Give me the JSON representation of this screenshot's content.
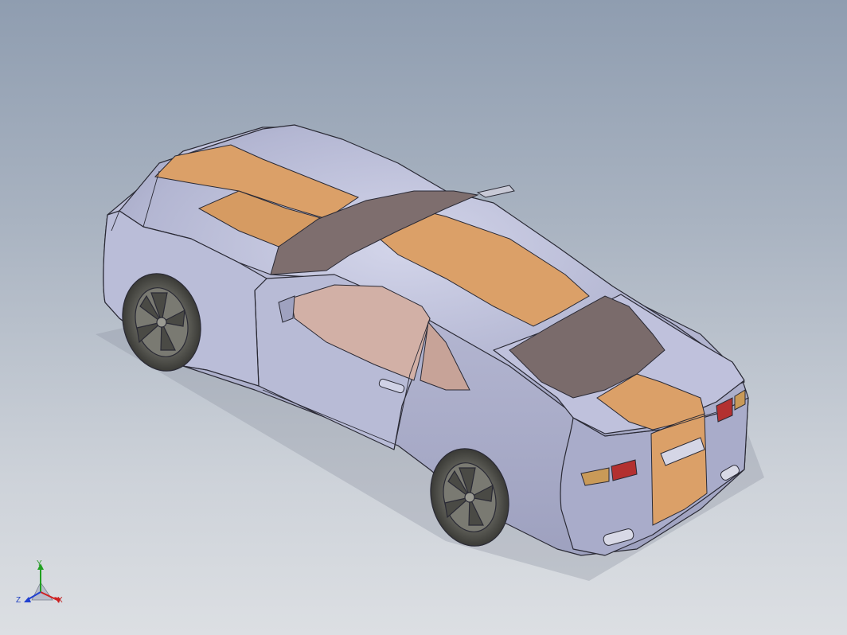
{
  "view": {
    "background_top": "#8f9db0",
    "background_bottom": "#dcdfe3",
    "model": {
      "body_color": "#b3b6d2",
      "body_shadow": "#8f92b0",
      "stripe_color": "#dba068",
      "glass_color": "#7e6e6e",
      "side_glass_color": "#d2b0a6",
      "tail_light_color": "#b33030",
      "wheel_color": "#5a5a55",
      "edge_color": "#2a2a35"
    }
  },
  "triad": {
    "x_label": "X",
    "y_label": "Y",
    "z_label": "Z",
    "x_color": "#d02020",
    "y_color": "#20a020",
    "z_color": "#2040d0",
    "icon": "coordinate-triad-icon"
  }
}
